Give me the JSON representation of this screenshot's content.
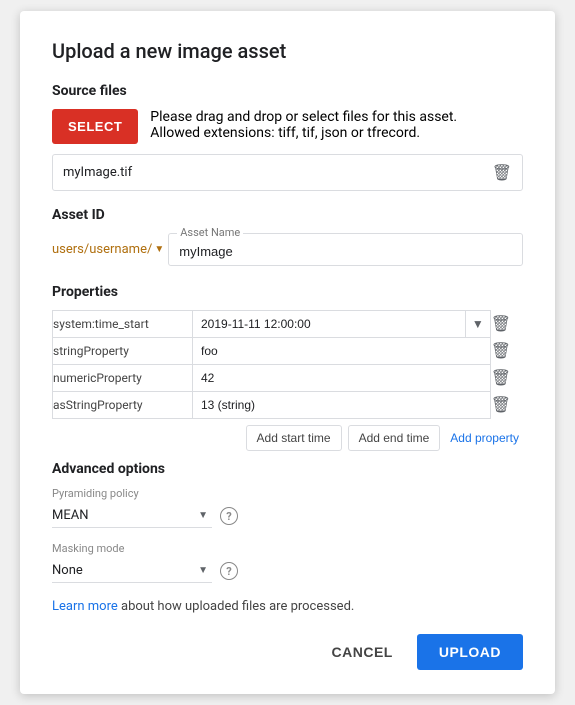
{
  "dialog": {
    "title": "Upload a new image asset"
  },
  "source_files": {
    "label": "Source files",
    "select_btn": "SELECT",
    "desc_line1": "Please drag and drop or select files for this asset.",
    "desc_line2": "Allowed extensions: tiff, tif, json or tfrecord.",
    "file_name": "myImage.tif"
  },
  "asset_id": {
    "label": "Asset ID",
    "prefix": "users/username/",
    "name_label": "Asset Name",
    "name_value": "myImage"
  },
  "properties": {
    "label": "Properties",
    "rows": [
      {
        "key": "system:time_start",
        "value": "2019-11-11 12:00:00",
        "has_dropdown": true
      },
      {
        "key": "stringProperty",
        "value": "foo",
        "has_dropdown": false
      },
      {
        "key": "numericProperty",
        "value": "42",
        "has_dropdown": false
      },
      {
        "key": "asStringProperty",
        "value": "13 (string)",
        "has_dropdown": false
      }
    ],
    "add_start_time_btn": "Add start time",
    "add_end_time_btn": "Add end time",
    "add_property_btn": "Add property"
  },
  "advanced": {
    "label": "Advanced options",
    "pyramiding_label": "Pyramiding policy",
    "pyramiding_value": "MEAN",
    "masking_label": "Masking mode",
    "masking_value": "None"
  },
  "learn_more": {
    "link_text": "Learn more",
    "text": " about how uploaded files are processed."
  },
  "footer": {
    "cancel_label": "CANCEL",
    "upload_label": "UPLOAD"
  }
}
